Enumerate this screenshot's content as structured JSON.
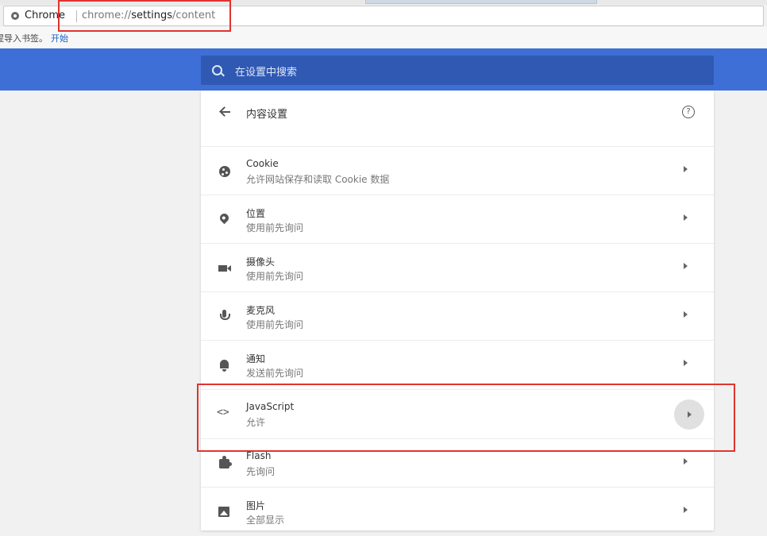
{
  "browser": {
    "site_label": "Chrome",
    "url_prefix": "chrome://",
    "url_bold": "settings",
    "url_suffix": "/content"
  },
  "bookmarks_bar": {
    "prompt_text": "提导入书签。",
    "start_link": "开始"
  },
  "search": {
    "placeholder": "在设置中搜索"
  },
  "page": {
    "title": "内容设置",
    "help_glyph": "?"
  },
  "rows": [
    {
      "icon": "cookie-icon",
      "title": "Cookie",
      "subtitle": "允许网站保存和读取 Cookie 数据"
    },
    {
      "icon": "location-pin-icon",
      "title": "位置",
      "subtitle": "使用前先询问"
    },
    {
      "icon": "camera-icon",
      "title": "摄像头",
      "subtitle": "使用前先询问"
    },
    {
      "icon": "microphone-icon",
      "title": "麦克风",
      "subtitle": "使用前先询问"
    },
    {
      "icon": "bell-icon",
      "title": "通知",
      "subtitle": "发送前先询问"
    },
    {
      "icon": "code-icon",
      "title": "JavaScript",
      "subtitle": "允许",
      "glyph": "<>"
    },
    {
      "icon": "puzzle-icon",
      "title": "Flash",
      "subtitle": "先询问"
    },
    {
      "icon": "image-icon",
      "title": "图片",
      "subtitle": "全部显示"
    }
  ],
  "colors": {
    "header_blue": "#3e6fd6",
    "search_blue": "#2f59b3",
    "highlight_red": "#e0342f"
  }
}
